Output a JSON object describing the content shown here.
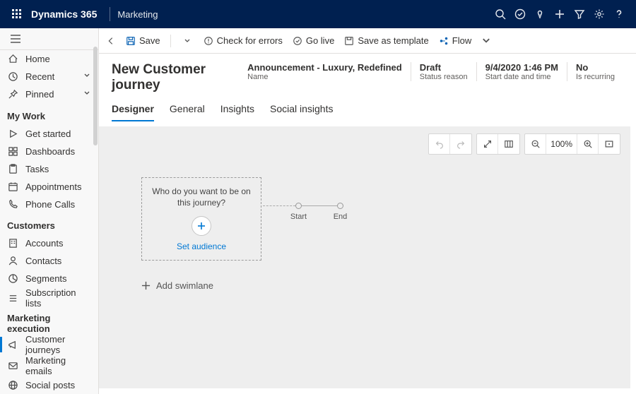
{
  "top": {
    "brand": "Dynamics 365",
    "app": "Marketing"
  },
  "sidebar": {
    "home": "Home",
    "recent": "Recent",
    "pinned": "Pinned",
    "mywork_head": "My Work",
    "getstarted": "Get started",
    "dashboards": "Dashboards",
    "tasks": "Tasks",
    "appointments": "Appointments",
    "phonecalls": "Phone Calls",
    "customers_head": "Customers",
    "accounts": "Accounts",
    "contacts": "Contacts",
    "segments": "Segments",
    "sublists": "Subscription lists",
    "exec_head": "Marketing execution",
    "journeys": "Customer journeys",
    "memails": "Marketing emails",
    "sposts": "Social posts"
  },
  "cmd": {
    "save": "Save",
    "check": "Check for errors",
    "golive": "Go live",
    "saveast": "Save as template",
    "flow": "Flow"
  },
  "header": {
    "title": "New Customer journey",
    "name_v": "Announcement - Luxury, Redefined",
    "name_k": "Name",
    "status_v": "Draft",
    "status_k": "Status reason",
    "start_v": "9/4/2020 1:46 PM",
    "start_k": "Start date and time",
    "recur_v": "No",
    "recur_k": "Is recurring"
  },
  "tabs": {
    "designer": "Designer",
    "general": "General",
    "insights": "Insights",
    "social": "Social insights"
  },
  "canvas": {
    "question": "Who do you want to be on this journey?",
    "set_audience": "Set audience",
    "start": "Start",
    "end": "End",
    "add_swimlane": "Add swimlane",
    "zoom": "100%"
  }
}
